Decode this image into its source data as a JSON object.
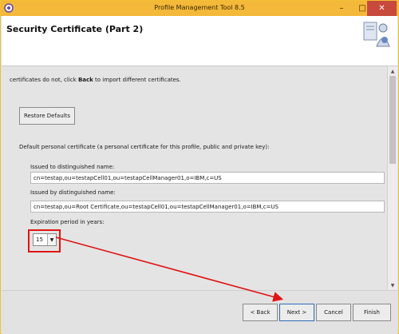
{
  "window": {
    "title": "Profile Management Tool 8.5",
    "minimize_glyph": "–",
    "maximize_glyph": "□",
    "close_glyph": "✕"
  },
  "banner": {
    "title": "Security Certificate (Part 2)"
  },
  "content": {
    "info_prefix": "certificates do not, click ",
    "info_bold": "Back",
    "info_suffix": " to import different certificates.",
    "restore_defaults": "Restore Defaults",
    "default_cert_label": "Default personal certificate (a personal certificate for this profile, public and private key):",
    "issued_to_label": "Issued to distinguished name:",
    "issued_to_value": "cn=testap,ou=testapCell01,ou=testapCellManager01,o=IBM,c=US",
    "issued_by_label": "Issued by distinguished name:",
    "issued_by_value": "cn=testap,ou=Root Certificate,ou=testapCell01,ou=testapCellManager01,o=IBM,c=US",
    "expiration_label": "Expiration period in years:",
    "expiration_value": "15"
  },
  "footer": {
    "back": "< Back",
    "next": "Next >",
    "cancel": "Cancel",
    "finish": "Finish"
  },
  "colors": {
    "titlebar": "#f4b83a",
    "annotation_red": "#e01414"
  },
  "icons": {
    "app": "app-icon",
    "banner_art": "certificate-figure-icon",
    "dropdown": "chevron-down-icon"
  }
}
